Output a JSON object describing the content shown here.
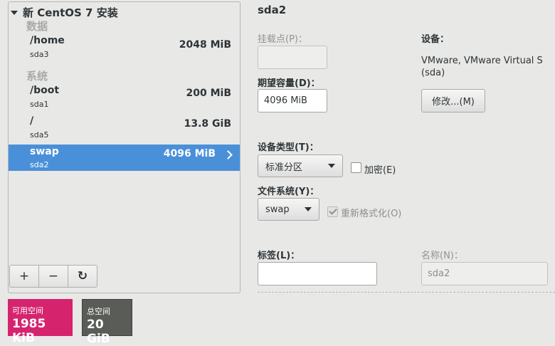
{
  "tree": {
    "header": "新 CentOS 7 安装",
    "groups": [
      {
        "label": "数据"
      },
      {
        "label": "系统"
      }
    ],
    "partitions": [
      {
        "mount": "/home",
        "device": "sda3",
        "size": "2048 MiB"
      },
      {
        "mount": "/boot",
        "device": "sda1",
        "size": "200 MiB"
      },
      {
        "mount": "/",
        "device": "sda5",
        "size": "13.8 GiB"
      },
      {
        "mount": "swap",
        "device": "sda2",
        "size": "4096 MiB"
      }
    ],
    "toolbar": {
      "add": "+",
      "remove": "−",
      "refresh": "↻"
    }
  },
  "space": {
    "available_label": "可用空间",
    "available_value": "1985 KiB",
    "total_label": "总空间",
    "total_value": "20 GiB"
  },
  "detail": {
    "title": "sda2",
    "mount_point_label": "挂载点(P)：",
    "mount_point_value": "",
    "desired_capacity_label": "期望容量(D)：",
    "desired_capacity_value": "4096 MiB",
    "device_label": "设备：",
    "device_value": "VMware, VMware Virtual S (sda)",
    "modify_button": "修改...(M)",
    "device_type_label": "设备类型(T)：",
    "device_type_value": "标准分区",
    "encrypt_label": "加密(E)",
    "filesystem_label": "文件系统(Y)：",
    "filesystem_value": "swap",
    "reformat_label": "重新格式化(O)",
    "tag_label": "标签(L)：",
    "tag_value": "",
    "name_label": "名称(N)：",
    "name_value": "sda2"
  },
  "colors": {
    "selected_row": "#4a90d9",
    "available_bg": "#d6236e",
    "total_bg": "#5a5c57"
  }
}
